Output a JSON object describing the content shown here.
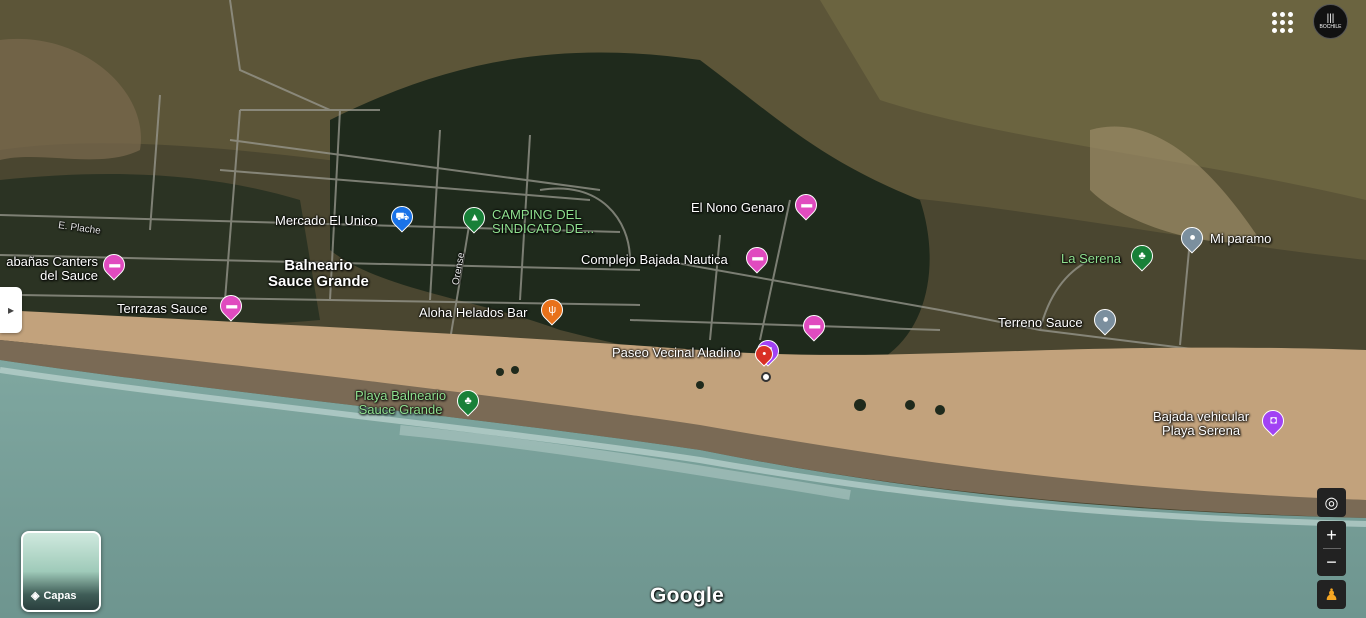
{
  "map": {
    "area_labels": {
      "balneario": "Balneario\nSauce Grande"
    },
    "street_labels": {
      "plache": "E. Plache",
      "orense": "Orense"
    },
    "places": [
      {
        "name": "Mercado El Unico",
        "icon": "shopping-cart-icon",
        "color": "#1a73e8"
      },
      {
        "name": "CAMPING DEL\nSINDICATO DE...",
        "icon": "campground-icon",
        "color": "#188038"
      },
      {
        "name": "El Nono Genaro",
        "icon": "hotel-bed-icon",
        "color": "#e04bbf"
      },
      {
        "name": "Complejo Bajada Nautica",
        "icon": "hotel-bed-icon",
        "color": "#e04bbf"
      },
      {
        "name": "abañas Canters\ndel Sauce",
        "icon": "hotel-bed-icon",
        "color": "#e04bbf"
      },
      {
        "name": "Terrazas Sauce",
        "icon": "hotel-bed-icon",
        "color": "#e04bbf"
      },
      {
        "name": "Aloha Helados Bar",
        "icon": "restaurant-icon",
        "color": "#e8711a"
      },
      {
        "name": "Paseo Vecinal Aladino",
        "icon": "red-location-pin-icon",
        "color": "#d93025"
      },
      {
        "name": "Playa Balneario\nSauce Grande",
        "icon": "tree-icon",
        "color": "#188038"
      },
      {
        "name": "La Serena",
        "icon": "tree-icon",
        "color": "#188038"
      },
      {
        "name": "Mi paramo",
        "icon": "location-dot-icon",
        "color": "#7b8f9e"
      },
      {
        "name": "Terreno Sauce",
        "icon": "location-dot-icon",
        "color": "#7b8f9e"
      },
      {
        "name": "Bajada vehicular\nPlaya Serena",
        "icon": "camera-icon",
        "color": "#a142f4"
      }
    ]
  },
  "controls": {
    "layers_label": "Capas",
    "zoom_in": "+",
    "zoom_out": "−",
    "google_logo": "Google",
    "avatar_text": "BOCHILE"
  }
}
